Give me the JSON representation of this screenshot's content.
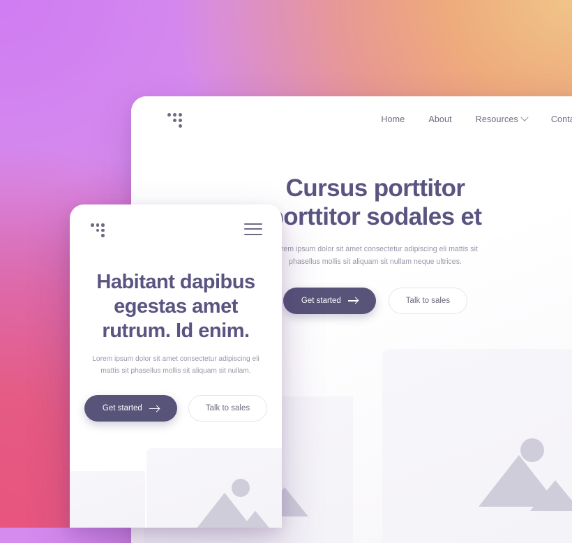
{
  "meta": {
    "scene": "website-mockup-landing-page",
    "colors": {
      "brand_purple": "#575379",
      "heading": "#595480",
      "body_text": "#9a96a8",
      "nav_text": "#6d6a7c",
      "card_white": "#ffffff",
      "placeholder_fill": "#f7f6fa",
      "placeholder_icon": "#cfcdda",
      "bg_gradient_top_left": "#d58aee",
      "bg_gradient_top_right": "#eeab7c",
      "bg_gradient_bottom_left": "#e8557e"
    }
  },
  "desktop": {
    "logo_icon": "dot-triangle-logo",
    "nav": [
      {
        "label": "Home",
        "has_caret": false
      },
      {
        "label": "About",
        "has_caret": false
      },
      {
        "label": "Resources",
        "has_caret": true
      },
      {
        "label": "Contact",
        "has_caret": false
      }
    ],
    "hero": {
      "title_line1": "Cursus porttitor",
      "title_line2": "porttitor sodales et",
      "subtitle": "Lorem ipsum dolor sit amet consectetur adipiscing eli mattis sit phasellus mollis sit aliquam sit nullam neque ultrices.",
      "primary_button": "Get started",
      "primary_button_icon": "arrow-right-icon",
      "secondary_button": "Talk to sales"
    },
    "placeholders": [
      {
        "name": "image-placeholder-right",
        "icon": "image-placeholder-icon"
      },
      {
        "name": "image-placeholder-left",
        "icon": "image-placeholder-icon"
      }
    ]
  },
  "mobile": {
    "logo_icon": "dot-triangle-logo",
    "menu_icon": "hamburger-menu-icon",
    "hero": {
      "title_line1": "Habitant dapibus",
      "title_line2": "egestas amet",
      "title_line3": "rutrum. Id enim.",
      "subtitle": "Lorem ipsum dolor sit amet consectetur adipiscing eli mattis sit phasellus mollis sit aliquam sit nullam.",
      "primary_button": "Get started",
      "primary_button_icon": "arrow-right-icon",
      "secondary_button": "Talk to sales"
    },
    "placeholders": [
      {
        "name": "image-placeholder-mobile",
        "icon": "image-placeholder-icon"
      }
    ]
  }
}
